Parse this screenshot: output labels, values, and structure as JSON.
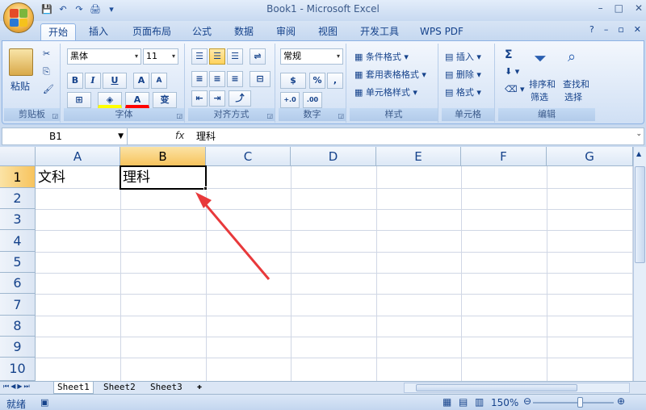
{
  "window": {
    "title": "Book1 - Microsoft Excel",
    "min": "–",
    "max": "□",
    "close": "✕"
  },
  "qat": [
    "💾",
    "↶",
    "↷",
    "🖨",
    "▾"
  ],
  "tabs": [
    {
      "label": "开始",
      "active": true
    },
    {
      "label": "插入"
    },
    {
      "label": "页面布局"
    },
    {
      "label": "公式"
    },
    {
      "label": "数据"
    },
    {
      "label": "审阅"
    },
    {
      "label": "视图"
    },
    {
      "label": "开发工具"
    },
    {
      "label": "WPS PDF"
    }
  ],
  "tab_right": {
    "help": "?",
    "min": "–",
    "restore": "▫",
    "close": "✕"
  },
  "ribbon": {
    "clipboard": {
      "label": "剪贴板",
      "paste": "粘贴",
      "cut": "✂",
      "copy": "⎘",
      "brush": "🖌"
    },
    "font": {
      "label": "字体",
      "name": "黑体",
      "size": "11",
      "bold": "B",
      "italic": "I",
      "underline": "U",
      "grow": "A",
      "shrink": "A",
      "border": "⊞",
      "fill": "◈",
      "color": "A",
      "phonetic": "变"
    },
    "align": {
      "label": "对齐方式"
    },
    "number": {
      "label": "数字",
      "format": "常规",
      "percent": "%",
      "comma": ",",
      "inc": "+.0",
      "dec": ".00"
    },
    "styles": {
      "label": "样式",
      "cond": "条件格式",
      "table": "套用表格格式",
      "cell": "单元格样式"
    },
    "cells": {
      "label": "单元格",
      "insert": "插入",
      "delete": "删除",
      "format": "格式"
    },
    "edit": {
      "label": "编辑",
      "sigma": "Σ",
      "sort": "排序和",
      "sort2": "筛选",
      "find": "查找和",
      "find2": "选择"
    }
  },
  "formula_bar": {
    "name": "B1",
    "fx": "fx",
    "value": "理科"
  },
  "columns": [
    "A",
    "B",
    "C",
    "D",
    "E",
    "F",
    "G"
  ],
  "rows": [
    "1",
    "2",
    "3",
    "4",
    "5",
    "6",
    "7",
    "8",
    "9",
    "10"
  ],
  "cells": {
    "A1": "文科",
    "B1": "理科"
  },
  "sheets": [
    {
      "label": "Sheet1",
      "active": true
    },
    {
      "label": "Sheet2"
    },
    {
      "label": "Sheet3"
    }
  ],
  "status": {
    "ready": "就绪",
    "zoom": "150%"
  },
  "colors": {
    "accent": "#15428b",
    "selected_header": "#f7c35d",
    "arrow": "#e8393b"
  }
}
